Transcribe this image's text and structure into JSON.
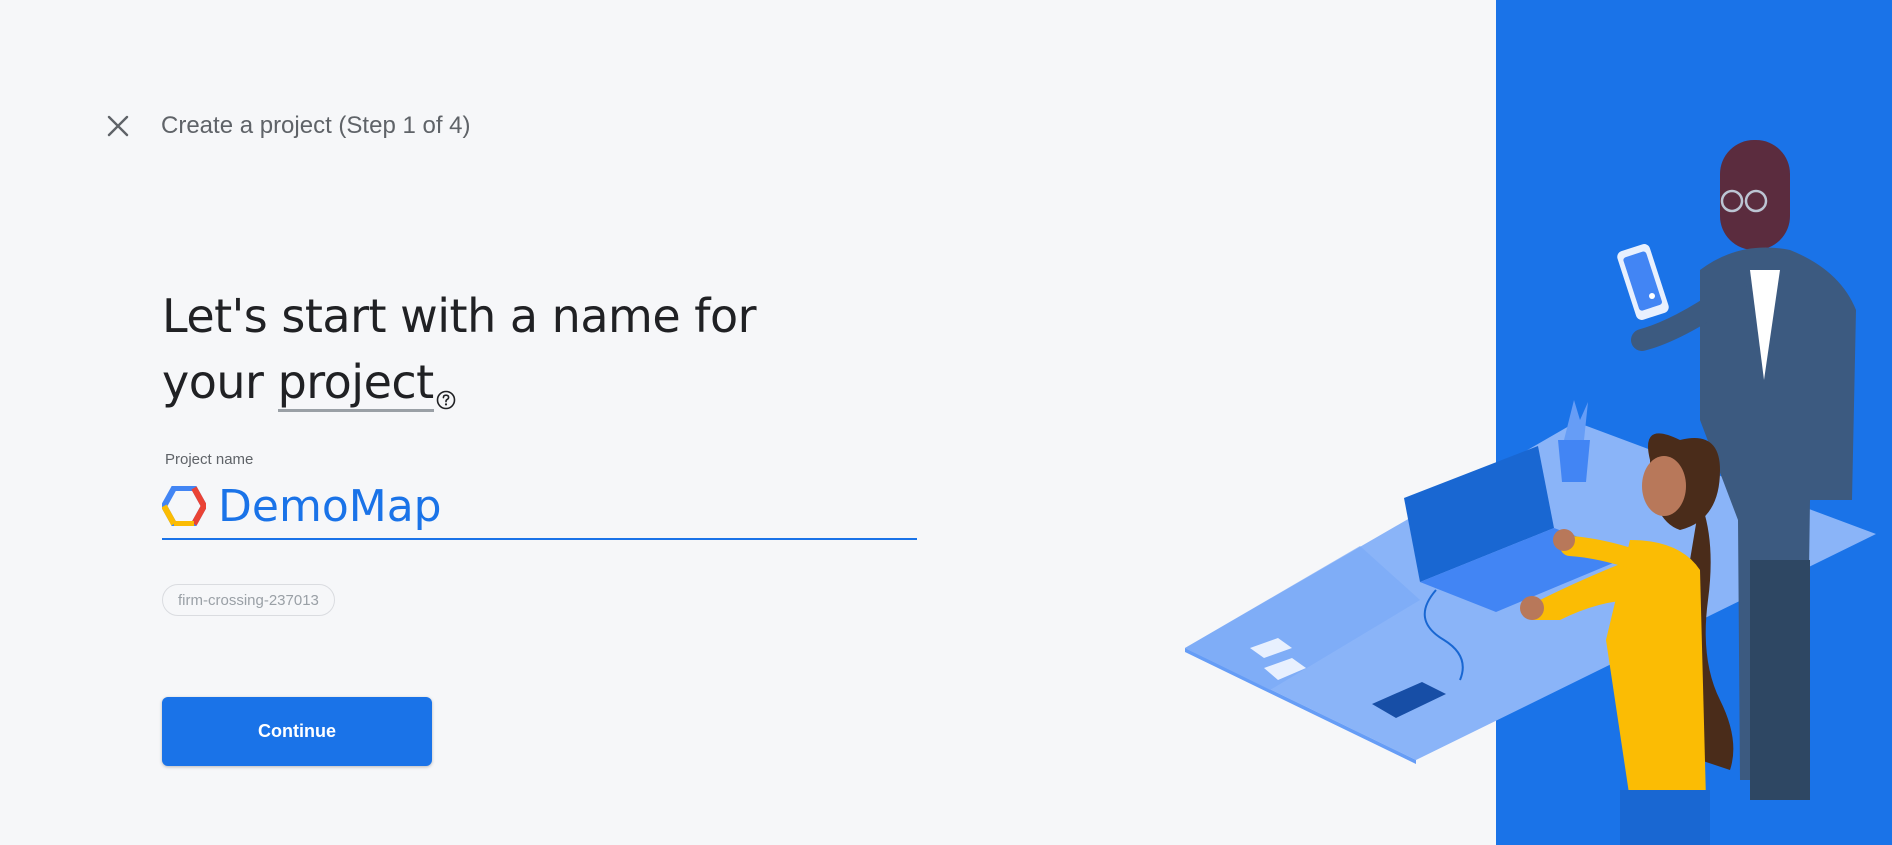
{
  "header": {
    "title": "Create a project (Step 1 of 4)",
    "close_icon": "close-icon"
  },
  "main": {
    "heading_line1": "Let's start with a name for",
    "heading_line2_prefix": "your ",
    "heading_line2_link": "project",
    "help_icon": "help-circle-icon",
    "field_label": "Project name",
    "project_name_value": "DemoMap",
    "project_id_chip": "firm-crossing-237013",
    "continue_label": "Continue"
  },
  "colors": {
    "accent": "#1a73e8",
    "panel_blue": "#1a73e8",
    "background": "#f6f7f9"
  }
}
